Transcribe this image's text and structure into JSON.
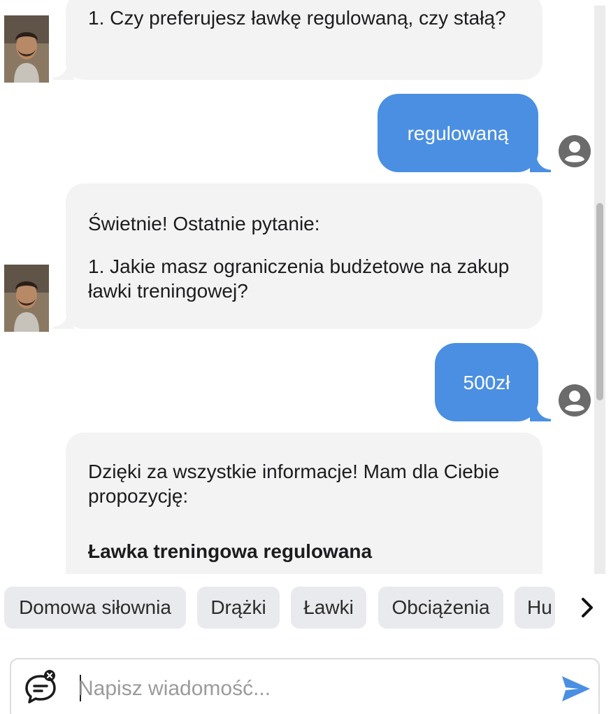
{
  "messages": [
    {
      "role": "bot",
      "lines": [
        "1. Czy preferujesz ławkę regulowaną, czy stałą?"
      ]
    },
    {
      "role": "user",
      "text": "regulowaną"
    },
    {
      "role": "bot",
      "lines": [
        "Świetnie! Ostatnie pytanie:",
        "1. Jakie masz ograniczenia budżetowe na zakup ławki treningowej?"
      ]
    },
    {
      "role": "user",
      "text": "500zł"
    },
    {
      "role": "bot",
      "lines": [
        "Dzięki za wszystkie informacje! Mam dla Ciebie propozycję:",
        "Ławka treningowa regulowana"
      ]
    }
  ],
  "chips": [
    "Domowa siłownia",
    "Drążki",
    "Ławki",
    "Obciążenia",
    "Hu"
  ],
  "composer": {
    "placeholder": "Napisz wiadomość..."
  },
  "icons": {
    "user": "account-circle-icon",
    "next": "chevron-right-icon",
    "chat_toggle": "chat-bubble-close-icon",
    "send": "send-icon"
  },
  "colors": {
    "user_bubble": "#4a8fe2",
    "bot_bubble": "#f3f3f4",
    "chip_bg": "#e9eaee",
    "send_icon": "#4a8fe2"
  }
}
